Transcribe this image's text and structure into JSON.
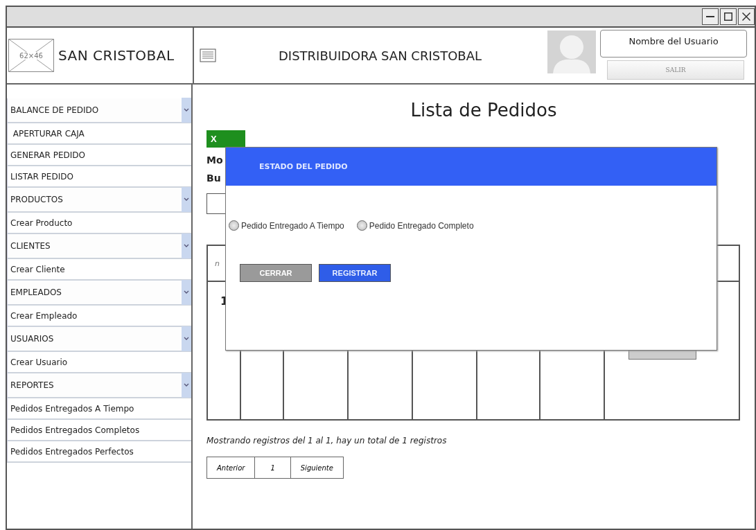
{
  "header": {
    "logo_placeholder": "62×46",
    "brand": "SAN CRISTOBAL",
    "title": "DISTRIBUIDORA SAN CRISTOBAL",
    "user_name": "Nombre del Usuario",
    "logout": "SALIR"
  },
  "sidebar": {
    "items": [
      {
        "kind": "group",
        "label": "BALANCE DE PEDIDO"
      },
      {
        "kind": "link",
        "label": " APERTURAR CAJA"
      },
      {
        "kind": "link",
        "label": "GENERAR PEDIDO"
      },
      {
        "kind": "link",
        "label": "LISTAR PEDIDO"
      },
      {
        "kind": "group",
        "label": "PRODUCTOS"
      },
      {
        "kind": "link",
        "label": "Crear Producto"
      },
      {
        "kind": "group",
        "label": "CLIENTES"
      },
      {
        "kind": "link",
        "label": "Crear Cliente"
      },
      {
        "kind": "group",
        "label": "EMPLEADOS"
      },
      {
        "kind": "link",
        "label": "Crear Empleado"
      },
      {
        "kind": "group",
        "label": "USUARIOS"
      },
      {
        "kind": "link",
        "label": "Crear Usuario"
      },
      {
        "kind": "group",
        "label": "REPORTES"
      },
      {
        "kind": "link",
        "label": "Pedidos Entregados A Tiempo"
      },
      {
        "kind": "link",
        "label": "Pedidos Entregados Completos"
      },
      {
        "kind": "link",
        "label": "Pedidos Entregados Perfectos"
      }
    ]
  },
  "main": {
    "title": "Lista de Pedidos",
    "export_button": "X",
    "show_label": "Mo",
    "search_label": "Bu",
    "table": {
      "header_fragment": "n",
      "row_number": "1"
    },
    "summary": "Mostrando registros del 1 al 1, hay un total de 1 registros",
    "pagination": [
      {
        "label": "Anterior"
      },
      {
        "label": "1"
      },
      {
        "label": "Siguiente"
      }
    ]
  },
  "modal": {
    "title": "ESTADO DEL PEDIDO",
    "options": [
      {
        "label": "Pedido Entregado A Tiempo",
        "selected": false
      },
      {
        "label": "Pedido Entregado Completo",
        "selected": false
      }
    ],
    "buttons": [
      {
        "label": "CERRAR",
        "disabled": true
      },
      {
        "label": "REGISTRAR",
        "disabled": false
      }
    ]
  }
}
